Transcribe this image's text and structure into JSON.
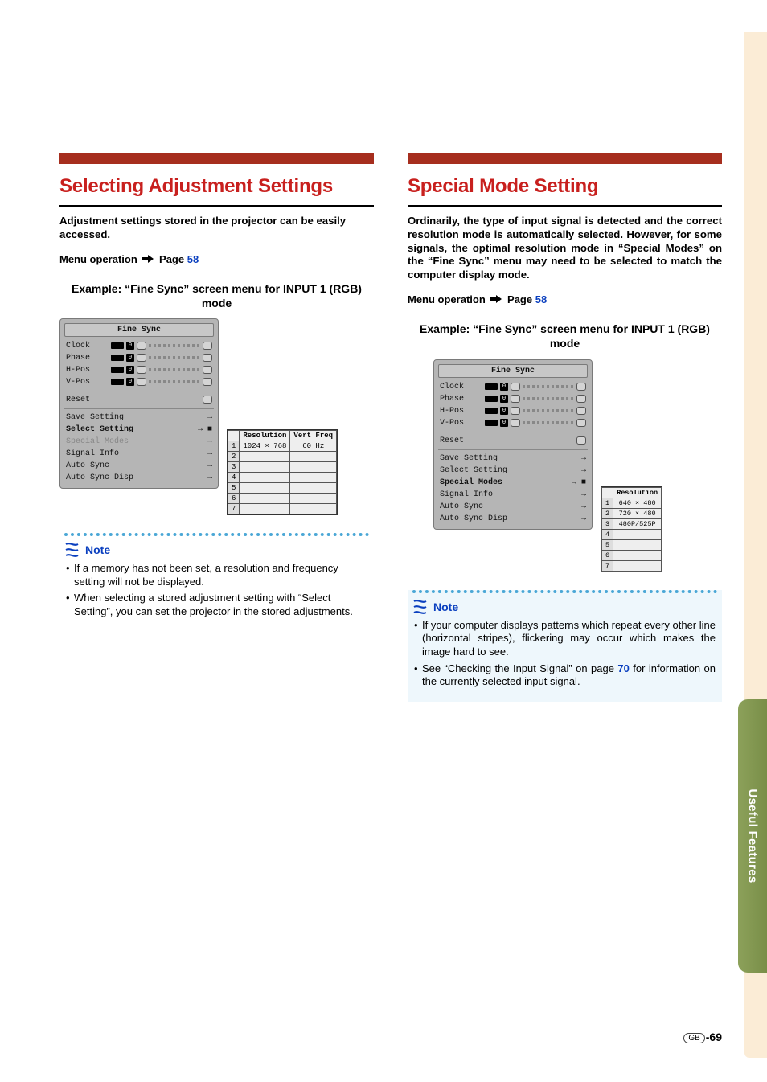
{
  "left": {
    "heading": "Selecting Adjustment Settings",
    "intro": "Adjustment settings stored in the projector can be easily accessed.",
    "menu_op_prefix": "Menu operation",
    "menu_op_page_label": "Page",
    "menu_op_page_num": "58",
    "example": "Example: “Fine Sync” screen menu for INPUT 1 (RGB) mode",
    "osd": {
      "title": "Fine Sync",
      "sliders": [
        "Clock",
        "Phase",
        "H-Pos",
        "V-Pos"
      ],
      "slider_value": "0",
      "reset": "Reset",
      "items": [
        {
          "label": "Save Setting",
          "dim": false,
          "sel": false
        },
        {
          "label": "Select Setting",
          "dim": false,
          "sel": true
        },
        {
          "label": "Special Modes",
          "dim": true,
          "sel": false
        },
        {
          "label": "Signal Info",
          "dim": false,
          "sel": false
        },
        {
          "label": "Auto Sync",
          "dim": false,
          "sel": false
        },
        {
          "label": "Auto Sync Disp",
          "dim": false,
          "sel": false
        }
      ],
      "popup": {
        "headers": [
          "Resolution",
          "Vert Freq"
        ],
        "rows": [
          [
            "1",
            "1024 × 768",
            "60 Hz"
          ],
          [
            "2",
            "",
            ""
          ],
          [
            "3",
            "",
            ""
          ],
          [
            "4",
            "",
            ""
          ],
          [
            "5",
            "",
            ""
          ],
          [
            "6",
            "",
            ""
          ],
          [
            "7",
            "",
            ""
          ]
        ]
      }
    },
    "note_label": "Note",
    "notes": [
      "If a memory has not been set, a resolution and frequency setting will not be displayed.",
      "When selecting a stored adjustment setting with “Select Setting”, you can set the projector in the stored adjustments."
    ]
  },
  "right": {
    "heading": "Special Mode Setting",
    "intro": "Ordinarily, the type of input signal is detected and the correct resolution mode is automatically selected. However, for some signals, the optimal resolution mode in “Special Modes” on the “Fine Sync” menu may need to be selected to match the computer display mode.",
    "menu_op_prefix": "Menu operation",
    "menu_op_page_label": "Page",
    "menu_op_page_num": "58",
    "example": "Example: “Fine Sync” screen menu for INPUT 1 (RGB) mode",
    "osd": {
      "title": "Fine Sync",
      "sliders": [
        "Clock",
        "Phase",
        "H-Pos",
        "V-Pos"
      ],
      "slider_value": "0",
      "reset": "Reset",
      "items": [
        {
          "label": "Save Setting",
          "dim": false,
          "sel": false
        },
        {
          "label": "Select Setting",
          "dim": false,
          "sel": false
        },
        {
          "label": "Special Modes",
          "dim": false,
          "sel": true
        },
        {
          "label": "Signal Info",
          "dim": false,
          "sel": false
        },
        {
          "label": "Auto Sync",
          "dim": false,
          "sel": false
        },
        {
          "label": "Auto Sync Disp",
          "dim": false,
          "sel": false
        }
      ],
      "popup": {
        "headers": [
          "Resolution"
        ],
        "rows": [
          [
            "1",
            "640 × 480"
          ],
          [
            "2",
            "720 × 480"
          ],
          [
            "3",
            "480P/525P"
          ],
          [
            "4",
            ""
          ],
          [
            "5",
            ""
          ],
          [
            "6",
            ""
          ],
          [
            "7",
            ""
          ]
        ]
      }
    },
    "note_label": "Note",
    "notes": [
      "If your computer displays patterns which repeat every other line (horizontal stripes), flickering may occur which makes the image hard to see.",
      "See “Checking the Input Signal” on page 70 for information on the currently selected input signal."
    ],
    "note2_link_page": "70"
  },
  "side_tab": "Useful Features",
  "footer": {
    "region": "GB",
    "page": "-69"
  }
}
